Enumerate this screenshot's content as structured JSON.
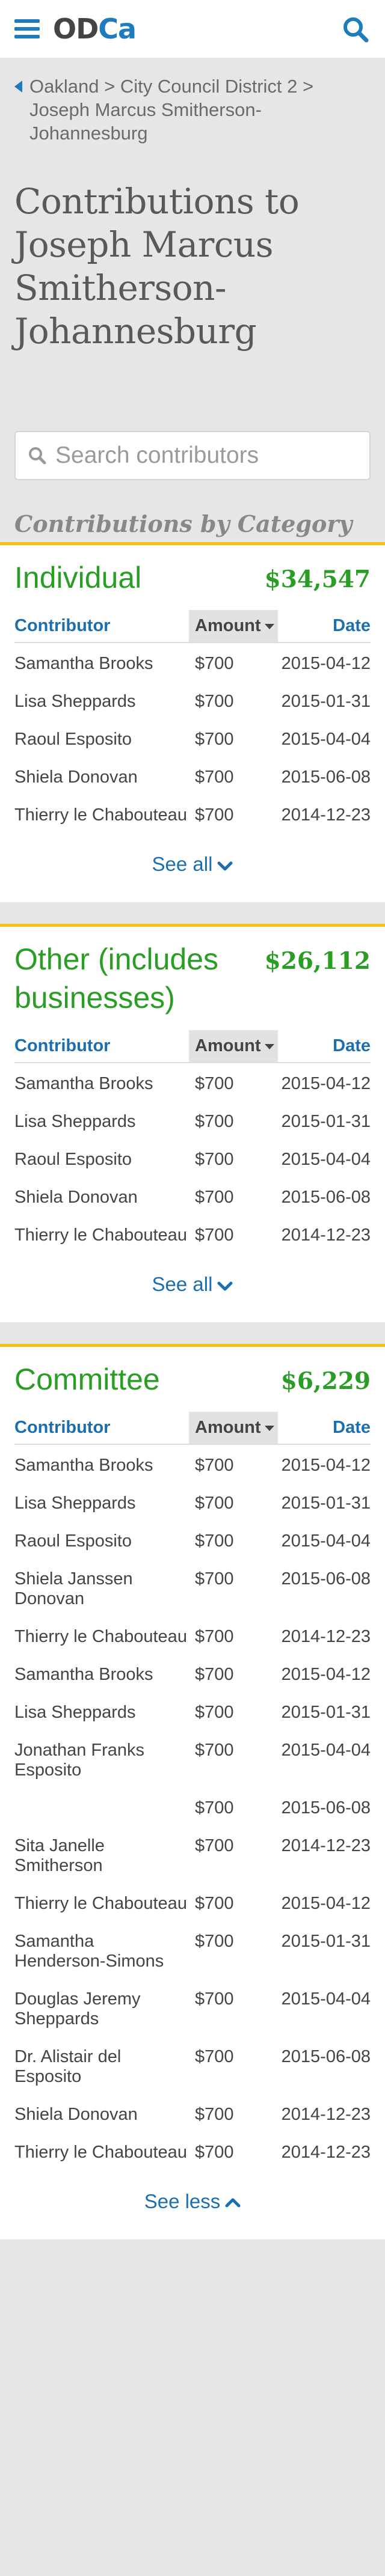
{
  "header": {
    "logo_od": "OD",
    "logo_ca": "Ca",
    "menu_icon": "hamburger-menu-icon",
    "search_icon": "search-icon",
    "accent": "#1c7cbd"
  },
  "breadcrumb": {
    "items": [
      "Oakland",
      "City Council District 2",
      "Joseph Marcus Smitherson-Johannesburg"
    ],
    "sep": ">"
  },
  "page": {
    "title": "Contributions to Joseph Marcus Smitherson-Johannesburg",
    "search_placeholder": "Search contributors",
    "section_heading": "Contributions by Category"
  },
  "table_headers": {
    "contributor": "Contributor",
    "amount": "Amount",
    "date": "Date"
  },
  "colors": {
    "green": "#2a9d25",
    "yellow_rule": "#f2c40f",
    "link_blue": "#1c6fae"
  },
  "categories": [
    {
      "name": "Individual",
      "total": "$34,547",
      "toggle_label": "See all",
      "toggle_icon": "chevron-down-icon",
      "rows": [
        {
          "contributor": "Samantha Brooks",
          "amount": "$700",
          "date": "2015-04-12"
        },
        {
          "contributor": "Lisa Sheppards",
          "amount": "$700",
          "date": "2015-01-31"
        },
        {
          "contributor": "Raoul Esposito",
          "amount": "$700",
          "date": "2015-04-04"
        },
        {
          "contributor": "Shiela Donovan",
          "amount": "$700",
          "date": "2015-06-08"
        },
        {
          "contributor": "Thierry le Chabouteau",
          "amount": "$700",
          "date": "2014-12-23"
        }
      ]
    },
    {
      "name": "Other (includes businesses)",
      "total": "$26,112",
      "toggle_label": "See all",
      "toggle_icon": "chevron-down-icon",
      "rows": [
        {
          "contributor": "Samantha Brooks",
          "amount": "$700",
          "date": "2015-04-12"
        },
        {
          "contributor": "Lisa Sheppards",
          "amount": "$700",
          "date": "2015-01-31"
        },
        {
          "contributor": "Raoul Esposito",
          "amount": "$700",
          "date": "2015-04-04"
        },
        {
          "contributor": "Shiela Donovan",
          "amount": "$700",
          "date": "2015-06-08"
        },
        {
          "contributor": "Thierry le Chabouteau",
          "amount": "$700",
          "date": "2014-12-23"
        }
      ]
    },
    {
      "name": "Committee",
      "total": "$6,229",
      "toggle_label": "See less",
      "toggle_icon": "chevron-up-icon",
      "rows": [
        {
          "contributor": "Samantha Brooks",
          "amount": "$700",
          "date": "2015-04-12"
        },
        {
          "contributor": "Lisa Sheppards",
          "amount": "$700",
          "date": "2015-01-31"
        },
        {
          "contributor": "Raoul Esposito",
          "amount": "$700",
          "date": "2015-04-04"
        },
        {
          "contributor": "Shiela Janssen Donovan",
          "amount": "$700",
          "date": "2015-06-08"
        },
        {
          "contributor": "Thierry le Chabouteau",
          "amount": "$700",
          "date": "2014-12-23"
        },
        {
          "contributor": "Samantha Brooks",
          "amount": "$700",
          "date": "2015-04-12"
        },
        {
          "contributor": "Lisa Sheppards",
          "amount": "$700",
          "date": "2015-01-31"
        },
        {
          "contributor": "Jonathan Franks Esposito",
          "amount": "$700",
          "date": "2015-04-04"
        },
        {
          "contributor": "",
          "amount": "$700",
          "date": "2015-06-08"
        },
        {
          "contributor": "Sita Janelle Smitherson",
          "amount": "$700",
          "date": "2014-12-23"
        },
        {
          "contributor": "Thierry le Chabouteau",
          "amount": "$700",
          "date": "2015-04-12"
        },
        {
          "contributor": "Samantha Henderson-Simons",
          "amount": "$700",
          "date": "2015-01-31"
        },
        {
          "contributor": "Douglas Jeremy Sheppards",
          "amount": "$700",
          "date": "2015-04-04"
        },
        {
          "contributor": "Dr. Alistair del Esposito",
          "amount": "$700",
          "date": "2015-06-08"
        },
        {
          "contributor": "Shiela Donovan",
          "amount": "$700",
          "date": "2014-12-23"
        },
        {
          "contributor": "Thierry le Chabouteau",
          "amount": "$700",
          "date": "2014-12-23"
        }
      ]
    }
  ]
}
